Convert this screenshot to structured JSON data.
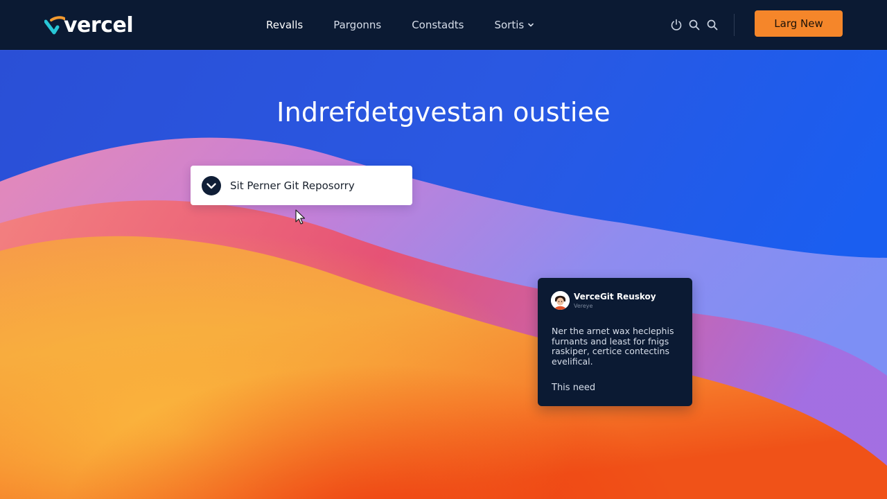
{
  "brand": {
    "name": "vercel",
    "logo_text": "vercel"
  },
  "nav": {
    "items": [
      {
        "label": "Revalls",
        "active": true
      },
      {
        "label": "Pargonns",
        "active": false
      },
      {
        "label": "Constadts",
        "active": false
      },
      {
        "label": "Sortis",
        "active": false,
        "has_dropdown": true
      }
    ],
    "icons": [
      "power-icon",
      "search-icon",
      "search-icon"
    ],
    "cta_label": "Larg New"
  },
  "hero": {
    "title": "Indrefdetgvestan oustiee",
    "select": {
      "label": "Sit Perner Git Reposorry",
      "icon": "chevron-check-icon"
    }
  },
  "info_card": {
    "title": "VerceGit Reuskoy",
    "subtitle": "Vereye",
    "body": "Ner the arnet wax heclephis furnants and least for fnigs raskiper, certice contectins evelifical.",
    "footer": "This need"
  },
  "colors": {
    "topbar_bg": "#0b1a33",
    "cta_bg": "#f5862a",
    "card_bg": "#0b1a33",
    "accent_teal": "#28c6d6",
    "accent_orange": "#f39a2f"
  }
}
